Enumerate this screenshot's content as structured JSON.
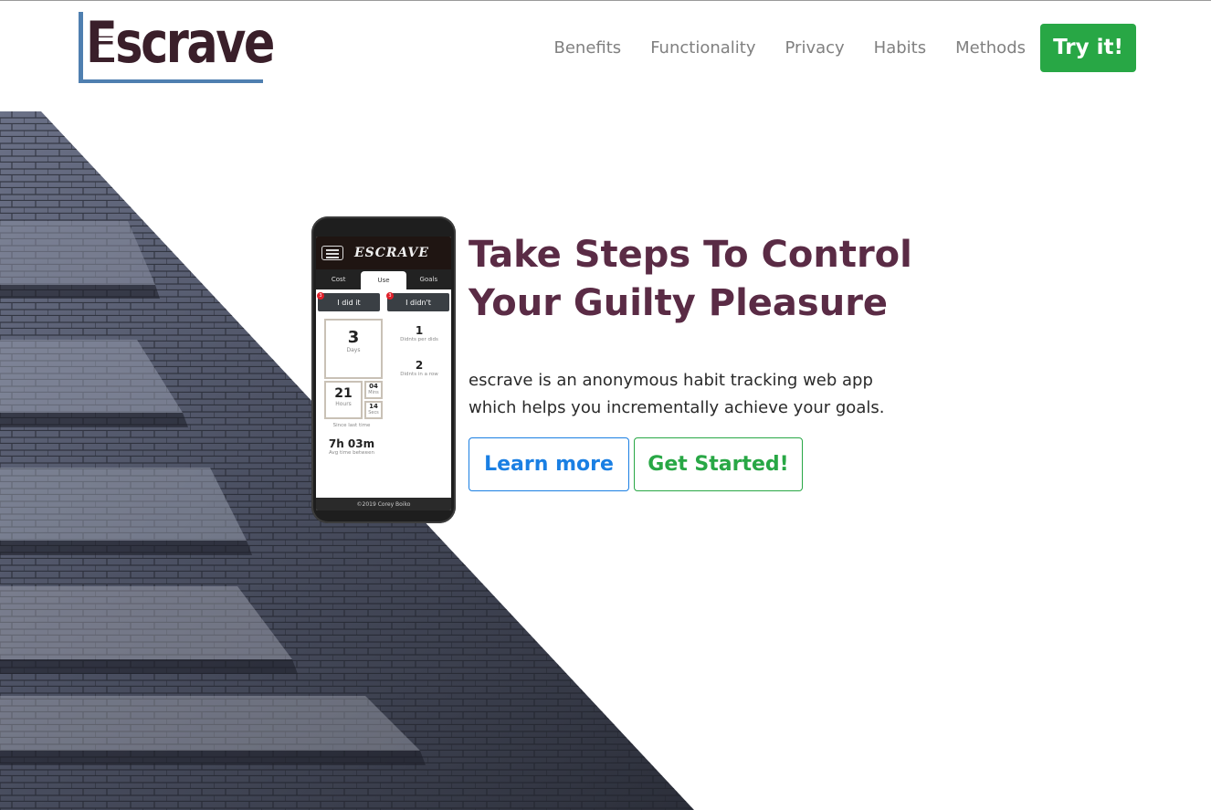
{
  "brand": {
    "name": "Escrave",
    "logo_text": "scrave"
  },
  "nav": {
    "items": [
      {
        "label": "Benefits"
      },
      {
        "label": "Functionality"
      },
      {
        "label": "Privacy"
      },
      {
        "label": "Habits"
      },
      {
        "label": "Methods"
      }
    ],
    "cta_label": "Try it!"
  },
  "hero": {
    "title_line1": "Take Steps To Control",
    "title_line2": "Your Guilty Pleasure",
    "desc_line1": "escrave is an anonymous habit tracking web app",
    "desc_line2": "which helps you incrementally achieve your goals.",
    "learn_more_label": "Learn more",
    "get_started_label": "Get Started!"
  },
  "phone": {
    "logo": "ESCRAVE",
    "tabs": [
      "Cost",
      "Use",
      "Goals"
    ],
    "did_label": "I did it",
    "didnt_label": "I didn't",
    "badge_count": "3",
    "days_value": "3",
    "days_label": "Days",
    "hours_value": "21",
    "hours_label": "Hours",
    "mins_value": "04",
    "mins_label": "Mins",
    "secs_value": "14",
    "secs_label": "Secs",
    "since_label": "Since last time",
    "didnts_per_did_value": "1",
    "didnts_per_did_label": "Didnts per dids",
    "didnts_row_value": "2",
    "didnts_row_label": "Didnts in a row",
    "avg_value": "7h 03m",
    "avg_label": "Avg time between",
    "footer": "©2019 Corey Boiko"
  },
  "colors": {
    "accent_green": "#28a745",
    "accent_blue": "#1a7fe3",
    "title": "#5a2b45",
    "logo": "#3a1f2a",
    "logo_bar": "#4f7fb0"
  }
}
